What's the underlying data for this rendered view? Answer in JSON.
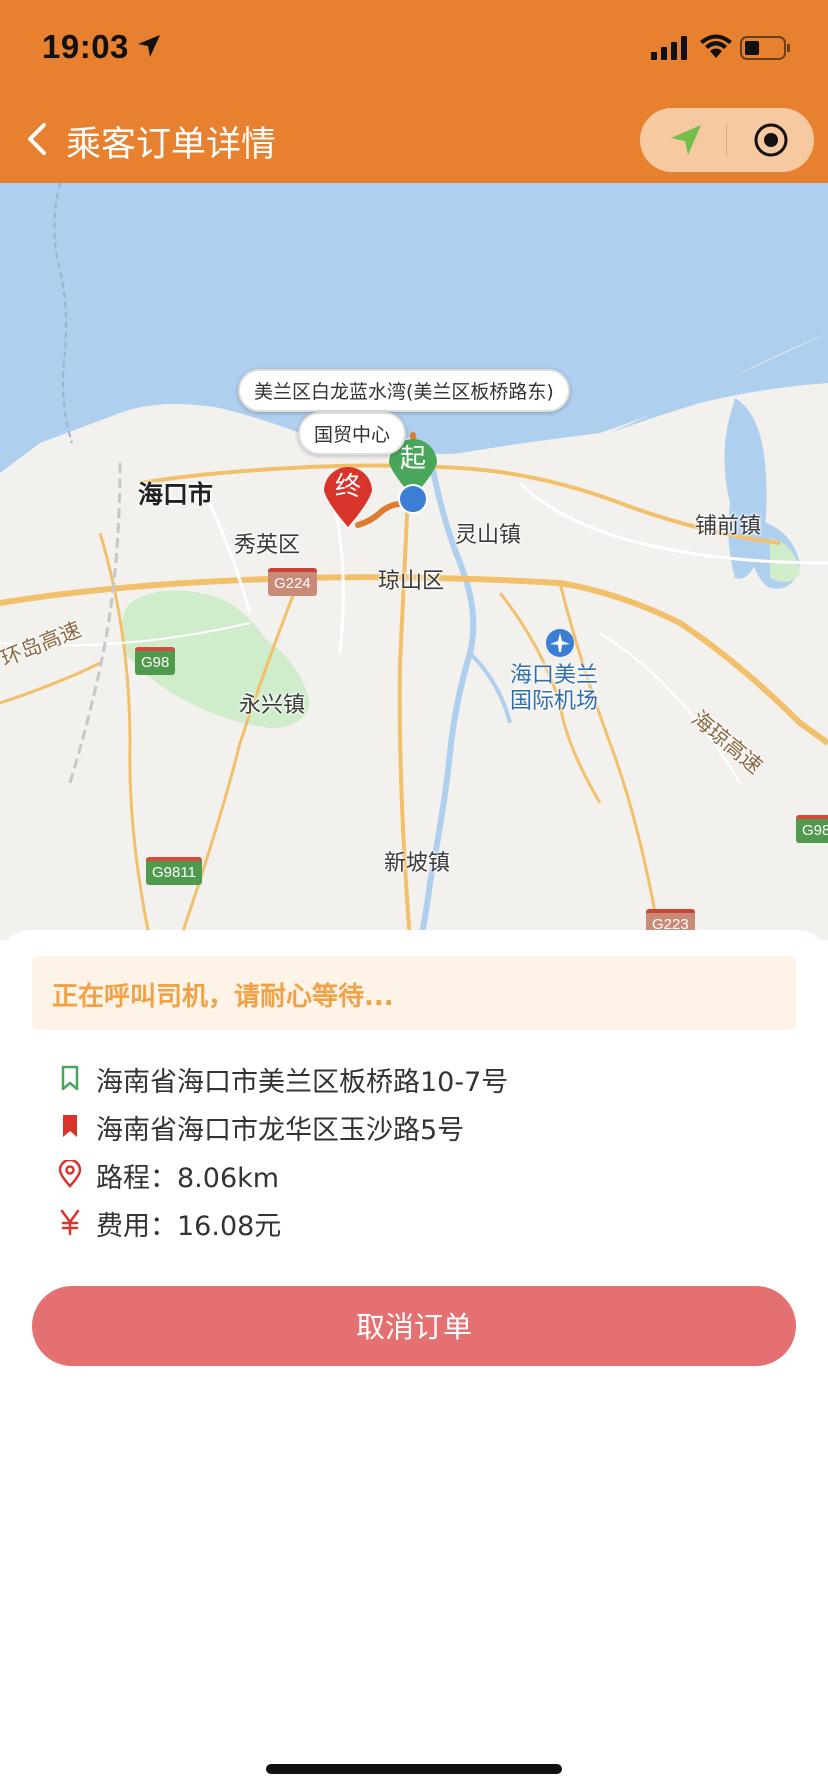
{
  "status_bar": {
    "time": "19:03"
  },
  "nav": {
    "title": "乘客订单详情"
  },
  "map": {
    "callout_top": "美兰区白龙蓝水湾(美兰区板桥路东)",
    "callout_mid": "国贸中心",
    "marker_start": "起",
    "marker_end": "终",
    "labels": {
      "haikou": "海口市",
      "xiuying": "秀英区",
      "qiongshan": "琼山区",
      "lingshan": "灵山镇",
      "puqian": "铺前镇",
      "airport_line1": "海口美兰",
      "airport_line2": "国际机场",
      "yongxing": "永兴镇",
      "xinpo": "新坡镇",
      "ring_expressway_left": "环岛高速",
      "ring_expressway_right": "海琼高速"
    },
    "shields": {
      "g224": "G224",
      "g98": "G98",
      "g9811": "G9811",
      "g223": "G223",
      "g98_right": "G98"
    }
  },
  "sheet": {
    "notice": "正在呼叫司机，请耐心等待...",
    "start_address": "海南省海口市美兰区板桥路10-7号",
    "end_address": "海南省海口市龙华区玉沙路5号",
    "distance": "路程：8.06km",
    "fee": "费用：16.08元",
    "cancel_label": "取消订单"
  },
  "colors": {
    "header": "#e8812f",
    "notice_text": "#f0a247",
    "cancel_button": "#e57071",
    "start_marker": "#4aa65a",
    "end_marker": "#d9342b",
    "route": "#e07a2e"
  }
}
